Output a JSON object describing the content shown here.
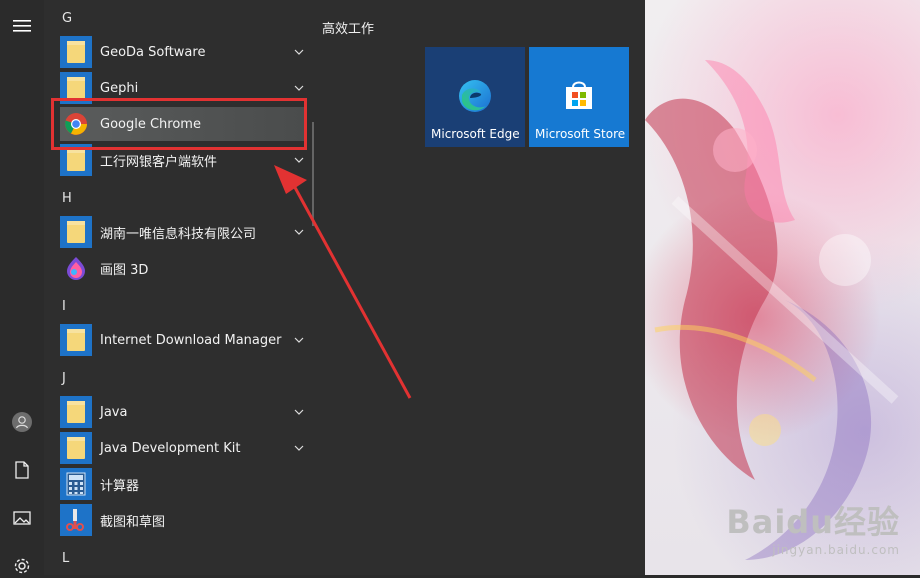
{
  "rail": {
    "menu_icon": "hamburger-icon",
    "user_icon": "user-icon",
    "documents_icon": "document-icon",
    "pictures_icon": "pictures-icon",
    "settings_icon": "gear-icon"
  },
  "applist": {
    "sections": [
      {
        "letter": "G"
      },
      {
        "letter": "H"
      },
      {
        "letter": "I"
      },
      {
        "letter": "J"
      },
      {
        "letter": "L"
      }
    ],
    "items": [
      {
        "label": "GeoDa Software",
        "icon": "folder-icon",
        "expandable": true
      },
      {
        "label": "Gephi",
        "icon": "folder-icon",
        "expandable": true
      },
      {
        "label": "Google Chrome",
        "icon": "chrome-icon",
        "expandable": false
      },
      {
        "label": "工行网银客户端软件",
        "icon": "folder-icon",
        "expandable": true
      },
      {
        "label": "湖南一唯信息科技有限公司",
        "icon": "folder-icon",
        "expandable": true
      },
      {
        "label": "画图 3D",
        "icon": "paint3d-icon",
        "expandable": false
      },
      {
        "label": "Internet Download Manager",
        "icon": "folder-icon",
        "expandable": true
      },
      {
        "label": "Java",
        "icon": "folder-icon",
        "expandable": true
      },
      {
        "label": "Java Development Kit",
        "icon": "folder-icon",
        "expandable": true
      },
      {
        "label": "计算器",
        "icon": "calculator-icon",
        "expandable": false
      },
      {
        "label": "截图和草图",
        "icon": "snip-sketch-icon",
        "expandable": false
      }
    ],
    "selected_label": "Google Chrome"
  },
  "tiles": {
    "group_title": "高效工作",
    "items": [
      {
        "label": "Microsoft Edge",
        "icon": "edge-icon",
        "color": "#1a3f75"
      },
      {
        "label": "Microsoft Store",
        "icon": "store-icon",
        "color": "#1679d2"
      }
    ]
  },
  "watermark": {
    "main": "Baidu经验",
    "sub": "jingyan.baidu.com"
  },
  "colors": {
    "highlight": "#e23232",
    "arrow": "#e23232",
    "folder_tile": "#1e73c8"
  }
}
